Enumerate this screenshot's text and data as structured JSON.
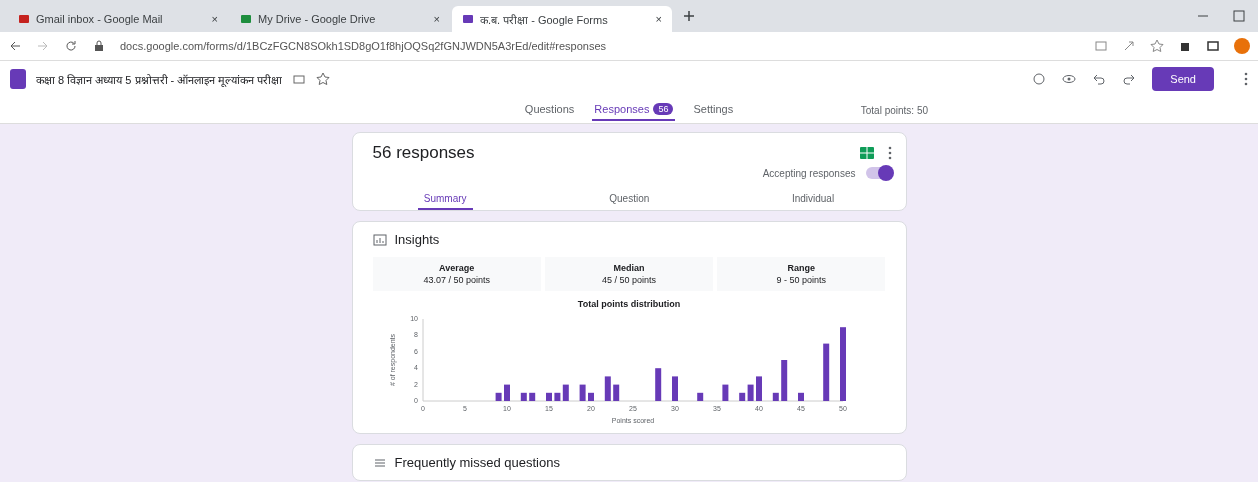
{
  "browser_tabs": [
    {
      "title": "Gmail inbox - Google Mail",
      "close": "×",
      "selected": false
    },
    {
      "title": "My Drive - Google Drive",
      "close": "×",
      "selected": false
    },
    {
      "title": "क.ब. परीक्षा - Google Forms",
      "close": "×",
      "selected": true
    }
  ],
  "address": "docs.google.com/forms/d/1BCzFGCN8SOkh1SD8gO1f8hjOQSq2fGNJWDN5A3rEd/edit#responses",
  "form": {
    "title": "कक्षा 8 विज्ञान अध्याय 5 प्रश्नोत्तरी - ऑनलाइन मूल्यांकन परीक्षा",
    "send": "Send"
  },
  "form_tabs": [
    {
      "label": "Questions",
      "selected": false
    },
    {
      "label": "Responses",
      "selected": true,
      "badge": "56"
    },
    {
      "label": "Settings",
      "selected": false
    }
  ],
  "total_points": "Total points: 50",
  "responses": {
    "count": "56 responses",
    "accepting_label": "Accepting responses",
    "accepting": true
  },
  "response_tabs": [
    {
      "label": "Summary",
      "selected": true
    },
    {
      "label": "Question",
      "selected": false
    },
    {
      "label": "Individual",
      "selected": false
    }
  ],
  "insights": {
    "title": "Insights",
    "stats": [
      {
        "label": "Average",
        "value": "43.07 / 50 points"
      },
      {
        "label": "Median",
        "value": "45 / 50 points"
      },
      {
        "label": "Range",
        "value": "9 - 50 points"
      }
    ],
    "chart_data": {
      "type": "bar",
      "title": "Total points distribution",
      "xlabel": "Points scored",
      "ylabel": "# of respondents",
      "x": [
        9,
        10,
        12,
        13,
        15,
        16,
        17,
        19,
        20,
        22,
        23,
        28,
        30,
        33,
        36,
        38,
        39,
        40,
        42,
        43,
        45,
        48,
        50
      ],
      "values": [
        1,
        2,
        1,
        1,
        1,
        1,
        2,
        2,
        1,
        3,
        2,
        4,
        3,
        1,
        2,
        1,
        2,
        3,
        1,
        5,
        1,
        7,
        9
      ],
      "xlim": [
        0,
        50
      ],
      "ylim": [
        0,
        10
      ],
      "xticks": [
        0,
        5,
        10,
        15,
        20,
        25,
        30,
        35,
        40,
        45,
        50
      ],
      "yticks": [
        0,
        2,
        4,
        6,
        8,
        10
      ]
    }
  },
  "next_section": "Frequently missed questions"
}
